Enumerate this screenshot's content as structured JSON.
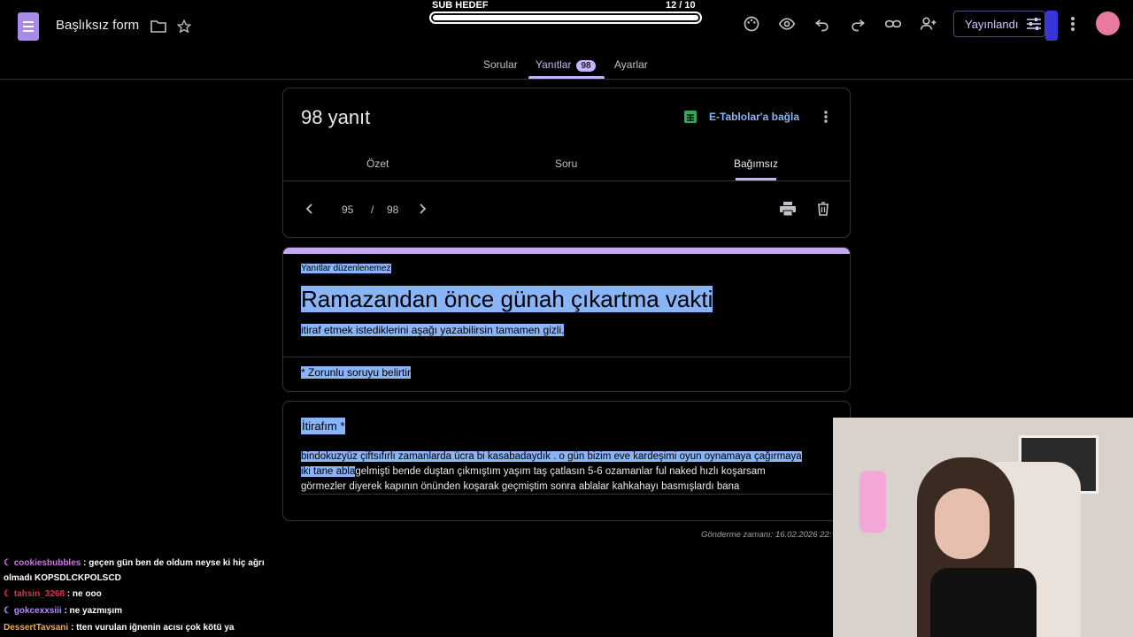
{
  "header": {
    "form_title": "Başlıksız form",
    "publish_label": "Yayınlandı",
    "icons": [
      "folder-icon",
      "star-icon",
      "palette-icon",
      "eye-icon",
      "undo-icon",
      "redo-icon",
      "link-icon",
      "add-person-icon",
      "tune-icon",
      "more-vert-icon"
    ]
  },
  "subgoal": {
    "label": "SUB HEDEF",
    "count_text": "12  / 10",
    "progress": 1.0
  },
  "tabs": [
    {
      "label": "Sorular"
    },
    {
      "label": "Yanıtlar",
      "badge": "98"
    },
    {
      "label": "Ayarlar"
    }
  ],
  "responses": {
    "count_title": "98 yanıt",
    "sheets_label": "E-Tablolar'a bağla",
    "subtabs": [
      "Özet",
      "Soru",
      "Bağımsız"
    ],
    "pager": {
      "current": "95",
      "separator": "/",
      "total": "98"
    }
  },
  "form_card": {
    "notice": "Yanıtlar düzenlenemez",
    "title": "Ramazandan önce günah çıkartma vakti",
    "description": "itiraf etmek istediklerini aşağı yazabilirsin tamamen gizli.",
    "required_note": "* Zorunlu soruyu belirtir"
  },
  "question_card": {
    "question": "İtirafım *",
    "answer_highlighted_1": "bindokuzyüz çiftsıfırlı zamanlarda ücra bi kasabadaydık . o gün bizim eve kardeşimi oyun oynamaya çağırmaya",
    "answer_highlighted_2": "iki tane abla",
    "answer_rest_1": "gelmişti bende duştan çıkmıştım yaşım taş çatlasın 5-6 ozamanlar ful naked hızlı koşarsam",
    "answer_rest_2": "görmezler diyerek kapının önünden koşarak geçmiştim sonra ablalar kahkahayı basmışlardı bana"
  },
  "submitted": "Gönderme zamanı: 16.02.2026 22:",
  "chat": [
    {
      "user": "cookiesbubbles",
      "color": "#c678dd",
      "text": ": geçen gün ben de oldum neyse ki hiç ağrı olmadı KOPSDLCKPOLSCD"
    },
    {
      "user": "tahsin_3268",
      "color": "#e0304a",
      "text": ": ne ooo"
    },
    {
      "user": "gokcexxsiii",
      "color": "#b48cff",
      "text": ": ne yazmışım"
    },
    {
      "user": "DessertTavsani",
      "color": "#f0b030",
      "text": ": tten vurulan iğnenin acısı çok kötü ya"
    }
  ]
}
